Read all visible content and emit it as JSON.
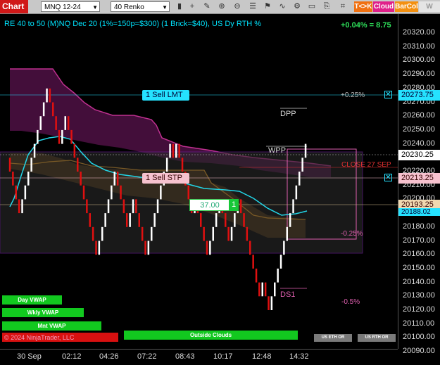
{
  "toolbar": {
    "chart_label": "Chart",
    "instrument": "MNQ 12-24",
    "bar_type": "40 Renko",
    "tags": {
      "tck": "T<>K",
      "cloud": "Cloud",
      "barcol": "BarCol",
      "vwap": "W VWA"
    }
  },
  "header": {
    "text": "RE 40 to 50 (M)NQ Dec 20 (1%=150p=$300) (1 Brick=$40), US Dy RTH %",
    "pct_change": "+0.04% = 8.75"
  },
  "y_axis": {
    "ticks": [
      "20320.00",
      "20310.00",
      "20300.00",
      "20290.00",
      "20280.00",
      "20270.00",
      "20260.00",
      "20250.00",
      "20240.00",
      "20230.00",
      "20220.00",
      "20210.00",
      "20200.00",
      "20190.00",
      "20180.00",
      "20170.00",
      "20160.00",
      "20150.00",
      "20140.00",
      "20130.00",
      "20120.00",
      "20110.00",
      "20100.00",
      "20090.00"
    ]
  },
  "x_axis": {
    "ticks": [
      "30 Sep",
      "02:12",
      "04:26",
      "07:22",
      "08:43",
      "10:17",
      "12:48",
      "14:32"
    ]
  },
  "price_tags": {
    "lmt": "20273.75",
    "current": "20230.25",
    "stp": "20213.25",
    "vwap": "20193.25",
    "cyan": "20188.02"
  },
  "orders": {
    "sell_lmt": "1 Sell LMT",
    "sell_stp": "1 Sell STP",
    "qty_value": "37.00",
    "qty_count": "1"
  },
  "labels": {
    "dpp": "DPP",
    "wpp": "WPP",
    "close": "CLOSE 27 SEP",
    "ds1": "DS1",
    "p025": "+0.25%",
    "m025": "-0.25%",
    "m05": "-0.5%"
  },
  "buttons": {
    "day_vwap": "Day VWAP",
    "wkly_vwap": "Wkly VWAP",
    "mnt_vwap": "Mnt VWAP",
    "outside_clouds": "Outside Clouds",
    "us_eth": "US ETH OR",
    "us_rth": "US RTH OR"
  },
  "copyright": "© 2024 NinjaTrader, LLC",
  "colors": {
    "up": "#ffffff",
    "down": "#e01010",
    "cyan": "#22d6e8",
    "orange": "#f0a020",
    "magenta": "#c03090"
  },
  "chart_data": {
    "type": "renko",
    "brick_size": 10,
    "ylim": [
      20085,
      20327
    ],
    "bricks": [
      {
        "o": 20230,
        "c": 20220
      },
      {
        "o": 20220,
        "c": 20210
      },
      {
        "o": 20210,
        "c": 20200
      },
      {
        "o": 20200,
        "c": 20190
      },
      {
        "o": 20190,
        "c": 20200
      },
      {
        "o": 20200,
        "c": 20210
      },
      {
        "o": 20210,
        "c": 20220
      },
      {
        "o": 20220,
        "c": 20230
      },
      {
        "o": 20230,
        "c": 20240
      },
      {
        "o": 20240,
        "c": 20250
      },
      {
        "o": 20250,
        "c": 20260
      },
      {
        "o": 20260,
        "c": 20270
      },
      {
        "o": 20270,
        "c": 20280
      },
      {
        "o": 20280,
        "c": 20270
      },
      {
        "o": 20270,
        "c": 20260
      },
      {
        "o": 20260,
        "c": 20250
      },
      {
        "o": 20250,
        "c": 20240
      },
      {
        "o": 20240,
        "c": 20250
      },
      {
        "o": 20250,
        "c": 20260
      },
      {
        "o": 20260,
        "c": 20250
      },
      {
        "o": 20250,
        "c": 20240
      },
      {
        "o": 20240,
        "c": 20230
      },
      {
        "o": 20230,
        "c": 20220
      },
      {
        "o": 20220,
        "c": 20210
      },
      {
        "o": 20210,
        "c": 20200
      },
      {
        "o": 20200,
        "c": 20190
      },
      {
        "o": 20190,
        "c": 20180
      },
      {
        "o": 20180,
        "c": 20170
      },
      {
        "o": 20170,
        "c": 20160
      },
      {
        "o": 20160,
        "c": 20170
      },
      {
        "o": 20170,
        "c": 20180
      },
      {
        "o": 20180,
        "c": 20190
      },
      {
        "o": 20190,
        "c": 20200
      },
      {
        "o": 20200,
        "c": 20210
      },
      {
        "o": 20210,
        "c": 20220
      },
      {
        "o": 20220,
        "c": 20210
      },
      {
        "o": 20210,
        "c": 20200
      },
      {
        "o": 20200,
        "c": 20190
      },
      {
        "o": 20190,
        "c": 20180
      },
      {
        "o": 20180,
        "c": 20190
      },
      {
        "o": 20190,
        "c": 20200
      },
      {
        "o": 20200,
        "c": 20190
      },
      {
        "o": 20190,
        "c": 20180
      },
      {
        "o": 20180,
        "c": 20170
      },
      {
        "o": 20170,
        "c": 20160
      },
      {
        "o": 20160,
        "c": 20170
      },
      {
        "o": 20170,
        "c": 20180
      },
      {
        "o": 20180,
        "c": 20190
      },
      {
        "o": 20190,
        "c": 20200
      },
      {
        "o": 20200,
        "c": 20210
      },
      {
        "o": 20210,
        "c": 20220
      },
      {
        "o": 20220,
        "c": 20230
      },
      {
        "o": 20230,
        "c": 20240
      },
      {
        "o": 20240,
        "c": 20230
      },
      {
        "o": 20230,
        "c": 20240
      },
      {
        "o": 20240,
        "c": 20230
      },
      {
        "o": 20230,
        "c": 20220
      },
      {
        "o": 20220,
        "c": 20210
      },
      {
        "o": 20210,
        "c": 20200
      },
      {
        "o": 20200,
        "c": 20190
      },
      {
        "o": 20190,
        "c": 20200
      },
      {
        "o": 20200,
        "c": 20190
      },
      {
        "o": 20190,
        "c": 20180
      },
      {
        "o": 20180,
        "c": 20170
      },
      {
        "o": 20170,
        "c": 20160
      },
      {
        "o": 20160,
        "c": 20170
      },
      {
        "o": 20170,
        "c": 20180
      },
      {
        "o": 20180,
        "c": 20190
      },
      {
        "o": 20190,
        "c": 20200
      },
      {
        "o": 20200,
        "c": 20190
      },
      {
        "o": 20190,
        "c": 20180
      },
      {
        "o": 20180,
        "c": 20170
      },
      {
        "o": 20170,
        "c": 20180
      },
      {
        "o": 20180,
        "c": 20190
      },
      {
        "o": 20190,
        "c": 20200
      },
      {
        "o": 20200,
        "c": 20190
      },
      {
        "o": 20190,
        "c": 20180
      },
      {
        "o": 20180,
        "c": 20170
      },
      {
        "o": 20170,
        "c": 20160
      },
      {
        "o": 20160,
        "c": 20150
      },
      {
        "o": 20150,
        "c": 20140
      },
      {
        "o": 20140,
        "c": 20130
      },
      {
        "o": 20130,
        "c": 20140
      },
      {
        "o": 20140,
        "c": 20130
      },
      {
        "o": 20130,
        "c": 20120
      },
      {
        "o": 20120,
        "c": 20130
      },
      {
        "o": 20130,
        "c": 20140
      },
      {
        "o": 20140,
        "c": 20150
      },
      {
        "o": 20150,
        "c": 20160
      },
      {
        "o": 20160,
        "c": 20170
      },
      {
        "o": 20170,
        "c": 20180
      },
      {
        "o": 20180,
        "c": 20190
      },
      {
        "o": 20190,
        "c": 20200
      },
      {
        "o": 20200,
        "c": 20210
      },
      {
        "o": 20210,
        "c": 20220
      },
      {
        "o": 20220,
        "c": 20230
      },
      {
        "o": 20230,
        "c": 20240
      }
    ]
  }
}
